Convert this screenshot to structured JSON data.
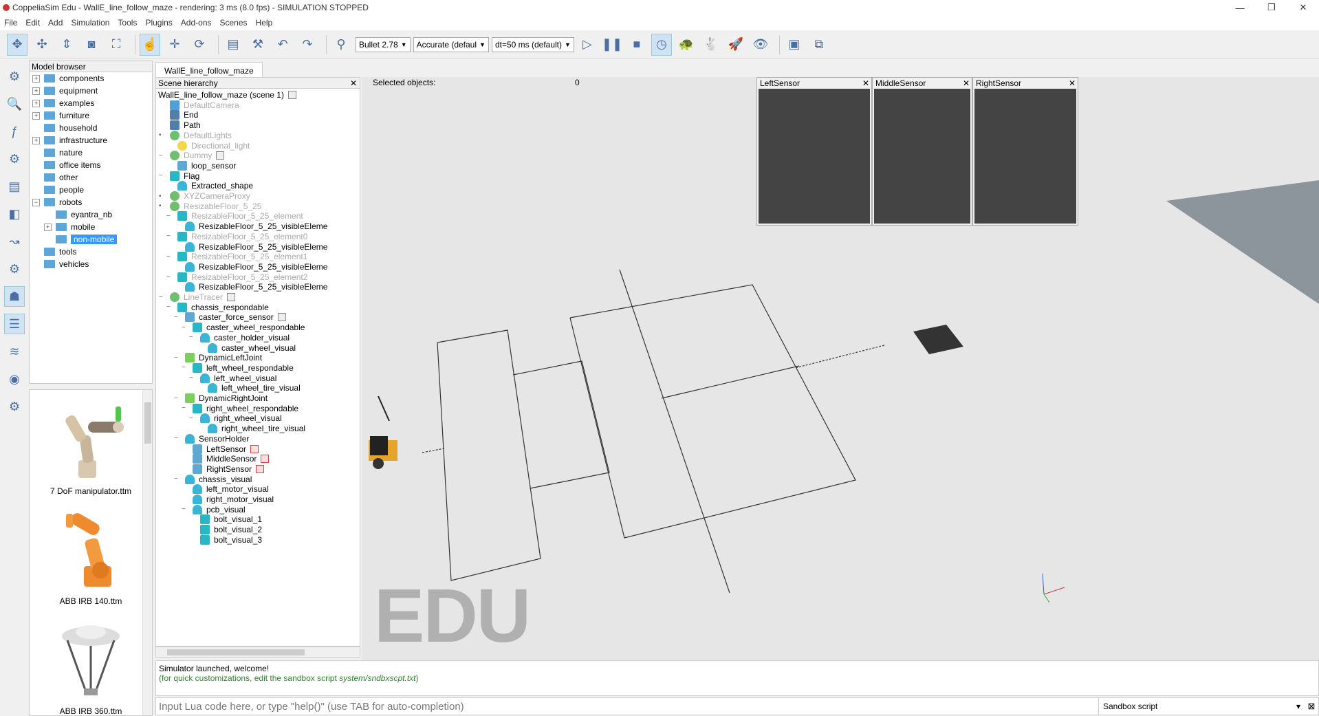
{
  "window": {
    "title": "CoppeliaSim Edu - WallE_line_follow_maze - rendering: 3 ms (8.0 fps) - SIMULATION STOPPED",
    "minimize": "—",
    "maximize": "❐",
    "close": "✕"
  },
  "menu": [
    "File",
    "Edit",
    "Add",
    "Simulation",
    "Tools",
    "Plugins",
    "Add-ons",
    "Scenes",
    "Help"
  ],
  "toolbar": {
    "engine": "Bullet 2.78",
    "accuracy": "Accurate (defaul",
    "timestep": "dt=50 ms (default)"
  },
  "model_browser": {
    "title": "Model browser",
    "items": [
      {
        "label": "components",
        "toggle": "+",
        "indent": 0
      },
      {
        "label": "equipment",
        "toggle": "+",
        "indent": 0
      },
      {
        "label": "examples",
        "toggle": "+",
        "indent": 0
      },
      {
        "label": "furniture",
        "toggle": "+",
        "indent": 0
      },
      {
        "label": "household",
        "toggle": "",
        "indent": 0
      },
      {
        "label": "infrastructure",
        "toggle": "+",
        "indent": 0
      },
      {
        "label": "nature",
        "toggle": "",
        "indent": 0
      },
      {
        "label": "office items",
        "toggle": "",
        "indent": 0
      },
      {
        "label": "other",
        "toggle": "",
        "indent": 0
      },
      {
        "label": "people",
        "toggle": "",
        "indent": 0
      },
      {
        "label": "robots",
        "toggle": "−",
        "indent": 0
      },
      {
        "label": "eyantra_nb",
        "toggle": "",
        "indent": 1
      },
      {
        "label": "mobile",
        "toggle": "+",
        "indent": 1
      },
      {
        "label": "non-mobile",
        "toggle": "",
        "indent": 1,
        "selected": true
      },
      {
        "label": "tools",
        "toggle": "",
        "indent": 0
      },
      {
        "label": "vehicles",
        "toggle": "",
        "indent": 0
      }
    ],
    "thumbnails": [
      "7 DoF manipulator.ttm",
      "ABB IRB 140.ttm",
      "ABB IRB 360.ttm"
    ]
  },
  "scene_tab": "WallE_line_follow_maze",
  "hierarchy": {
    "title": "Scene hierarchy",
    "close": "✕",
    "rows": [
      {
        "label": "WallE_line_follow_maze (scene 1)",
        "indent": 0,
        "icon": "none",
        "toggle": "",
        "script": true
      },
      {
        "label": "DefaultCamera",
        "indent": 1,
        "icon": "cam",
        "dim": true,
        "toggle": ""
      },
      {
        "label": "End",
        "indent": 1,
        "icon": "path",
        "toggle": ""
      },
      {
        "label": "Path",
        "indent": 1,
        "icon": "path",
        "toggle": ""
      },
      {
        "label": "DefaultLights",
        "indent": 1,
        "icon": "dummy",
        "dim": true,
        "toggle": "•"
      },
      {
        "label": "Directional_light",
        "indent": 2,
        "icon": "light",
        "dim": true,
        "toggle": ""
      },
      {
        "label": "Dummy",
        "indent": 1,
        "icon": "dummy",
        "dim": true,
        "toggle": "−",
        "script": true
      },
      {
        "label": "loop_sensor",
        "indent": 2,
        "icon": "sensor",
        "toggle": ""
      },
      {
        "label": "Flag",
        "indent": 1,
        "icon": "shape",
        "toggle": "−"
      },
      {
        "label": "Extracted_shape",
        "indent": 2,
        "icon": "cone",
        "toggle": ""
      },
      {
        "label": "XYZCameraProxy",
        "indent": 1,
        "icon": "dummy",
        "dim": true,
        "toggle": "•"
      },
      {
        "label": "ResizableFloor_5_25",
        "indent": 1,
        "icon": "dummy",
        "dim": true,
        "toggle": "•"
      },
      {
        "label": "ResizableFloor_5_25_element",
        "indent": 2,
        "icon": "shape",
        "dim": true,
        "toggle": "−"
      },
      {
        "label": "ResizableFloor_5_25_visibleEleme",
        "indent": 3,
        "icon": "cone",
        "toggle": ""
      },
      {
        "label": "ResizableFloor_5_25_element0",
        "indent": 2,
        "icon": "shape",
        "dim": true,
        "toggle": "−"
      },
      {
        "label": "ResizableFloor_5_25_visibleEleme",
        "indent": 3,
        "icon": "cone",
        "toggle": ""
      },
      {
        "label": "ResizableFloor_5_25_element1",
        "indent": 2,
        "icon": "shape",
        "dim": true,
        "toggle": "−"
      },
      {
        "label": "ResizableFloor_5_25_visibleEleme",
        "indent": 3,
        "icon": "cone",
        "toggle": ""
      },
      {
        "label": "ResizableFloor_5_25_element2",
        "indent": 2,
        "icon": "shape",
        "dim": true,
        "toggle": "−"
      },
      {
        "label": "ResizableFloor_5_25_visibleEleme",
        "indent": 3,
        "icon": "cone",
        "toggle": ""
      },
      {
        "label": "LineTracer",
        "indent": 1,
        "icon": "dummy",
        "dim": true,
        "toggle": "−",
        "script": true
      },
      {
        "label": "chassis_respondable",
        "indent": 2,
        "icon": "shape",
        "toggle": "−"
      },
      {
        "label": "caster_force_sensor",
        "indent": 3,
        "icon": "sensor",
        "toggle": "−",
        "script": true
      },
      {
        "label": "caster_wheel_respondable",
        "indent": 4,
        "icon": "shape",
        "toggle": "−"
      },
      {
        "label": "caster_holder_visual",
        "indent": 5,
        "icon": "cone",
        "toggle": "−"
      },
      {
        "label": "caster_wheel_visual",
        "indent": 6,
        "icon": "cone",
        "toggle": ""
      },
      {
        "label": "DynamicLeftJoint",
        "indent": 3,
        "icon": "joint",
        "toggle": "−"
      },
      {
        "label": "left_wheel_respondable",
        "indent": 4,
        "icon": "shape",
        "toggle": "−"
      },
      {
        "label": "left_wheel_visual",
        "indent": 5,
        "icon": "cone",
        "toggle": "−"
      },
      {
        "label": "left_wheel_tire_visual",
        "indent": 6,
        "icon": "cone",
        "toggle": ""
      },
      {
        "label": "DynamicRightJoint",
        "indent": 3,
        "icon": "joint",
        "toggle": "−"
      },
      {
        "label": "right_wheel_respondable",
        "indent": 4,
        "icon": "shape",
        "toggle": "−"
      },
      {
        "label": "right_wheel_visual",
        "indent": 5,
        "icon": "cone",
        "toggle": "−"
      },
      {
        "label": "right_wheel_tire_visual",
        "indent": 6,
        "icon": "cone",
        "toggle": ""
      },
      {
        "label": "SensorHolder",
        "indent": 3,
        "icon": "cone",
        "toggle": "−"
      },
      {
        "label": "LeftSensor",
        "indent": 4,
        "icon": "sensor",
        "toggle": "",
        "red": true
      },
      {
        "label": "MiddleSensor",
        "indent": 4,
        "icon": "sensor",
        "toggle": "",
        "red": true
      },
      {
        "label": "RightSensor",
        "indent": 4,
        "icon": "sensor",
        "toggle": "",
        "red": true
      },
      {
        "label": "chassis_visual",
        "indent": 3,
        "icon": "cone",
        "toggle": "−"
      },
      {
        "label": "left_motor_visual",
        "indent": 4,
        "icon": "cone",
        "toggle": ""
      },
      {
        "label": "right_motor_visual",
        "indent": 4,
        "icon": "cone",
        "toggle": ""
      },
      {
        "label": "pcb_visual",
        "indent": 4,
        "icon": "cone",
        "toggle": "−"
      },
      {
        "label": "bolt_visual_1",
        "indent": 5,
        "icon": "shape",
        "toggle": ""
      },
      {
        "label": "bolt_visual_2",
        "indent": 5,
        "icon": "shape",
        "toggle": ""
      },
      {
        "label": "bolt_visual_3",
        "indent": 5,
        "icon": "shape",
        "toggle": ""
      }
    ]
  },
  "viewport": {
    "selected_label": "Selected objects:",
    "selected_count": "0",
    "watermark": "EDU",
    "sensors": [
      "LeftSensor",
      "MiddleSensor",
      "RightSensor"
    ]
  },
  "console": {
    "line1": "Simulator launched, welcome!",
    "line2_prefix": "(for quick customizations, edit the sandbox script ",
    "line2_path": "system/sndbxscpt.txt",
    "line2_suffix": ")"
  },
  "lua_input": {
    "placeholder": "Input Lua code here, or type \"help()\" (use TAB for auto-completion)",
    "script_select": "Sandbox script"
  },
  "colors": {
    "selection": "#3399ff",
    "folder": "#5ea6d8",
    "shape": "#28b7c4",
    "floor": "#e6e6e6"
  }
}
